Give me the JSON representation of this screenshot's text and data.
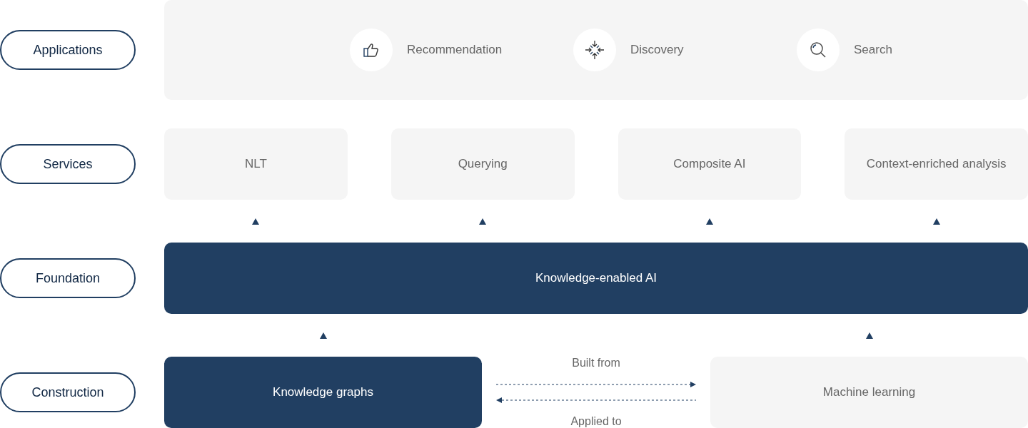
{
  "applications": {
    "label": "Applications",
    "items": [
      {
        "label": "Recommendation"
      },
      {
        "label": "Discovery"
      },
      {
        "label": "Search"
      }
    ]
  },
  "services": {
    "label": "Services",
    "items": [
      "NLT",
      "Querying",
      "Composite AI",
      "Context-enriched analysis"
    ]
  },
  "foundation": {
    "label": "Foundation",
    "title": "Knowledge-enabled AI"
  },
  "construction": {
    "label": "Construction",
    "left": {
      "label": "Knowledge graphs",
      "kind": "dark"
    },
    "right": {
      "label": "Machine learning",
      "kind": "light"
    },
    "forward": "Built from",
    "backward": "Applied to"
  }
}
